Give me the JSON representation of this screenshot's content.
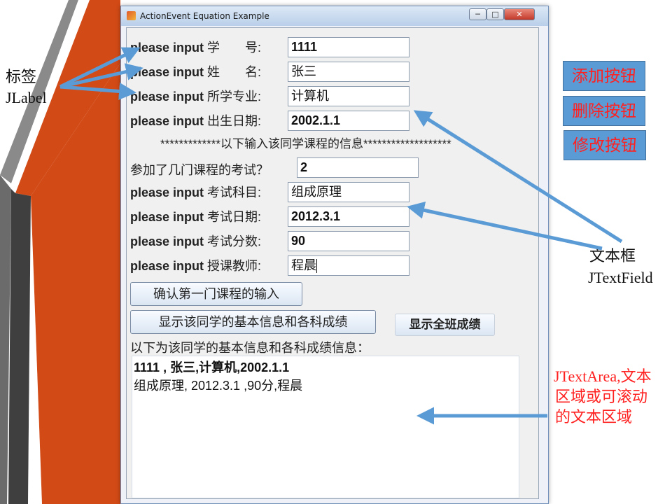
{
  "window": {
    "title": "ActionEvent Equation Example",
    "min_glyph": "─",
    "max_glyph": "□",
    "close_glyph": "✕"
  },
  "form": {
    "rows": [
      {
        "prefix": "please input",
        "label": "学　　号:",
        "value": "1111"
      },
      {
        "prefix": "please input",
        "label": "姓　　名:",
        "value": "张三"
      },
      {
        "prefix": "please input",
        "label": "所学专业:",
        "value": "计算机"
      },
      {
        "prefix": "please input",
        "label": "出生日期:",
        "value": "2002.1.1"
      }
    ],
    "separator": "*************以下输入该同学课程的信息*******************",
    "course_count_label": "参加了几门课程的考试？",
    "course_count_value": "2",
    "course_rows": [
      {
        "prefix": "please input",
        "label": "考试科目:",
        "value": "组成原理"
      },
      {
        "prefix": "please input",
        "label": "考试日期:",
        "value": "2012.3.1"
      },
      {
        "prefix": "please input",
        "label": "考试分数:",
        "value": "90"
      },
      {
        "prefix": "please input",
        "label": "授课教师:",
        "value": "程晨"
      }
    ],
    "confirm_button": "确认第一门课程的输入",
    "show_student_button": "显示该同学的基本信息和各科成绩",
    "show_class_button": "显示全班成绩",
    "result_label": "以下为该同学的基本信息和各科成绩信息：",
    "result_lines": [
      "1111 , 张三,计算机,2002.1.1",
      "组成原理, 2012.3.1 ,90分,程晨"
    ]
  },
  "annotations": {
    "label_cn": "标签",
    "label_en": "JLabel",
    "textfield_cn": "文本框",
    "textfield_en": "JTextField",
    "textarea_line1": "JTextArea,文本",
    "textarea_line2": "区域或可滚动",
    "textarea_line3": "的文本区域",
    "add_button": "添加按钮",
    "delete_button": "删除按钮",
    "edit_button": "修改按钮"
  },
  "colors": {
    "annotation_red": "#ff2020",
    "arrow_blue": "#5b9bd5",
    "slide_orange": "#d24a16",
    "slide_dark": "#404040"
  }
}
